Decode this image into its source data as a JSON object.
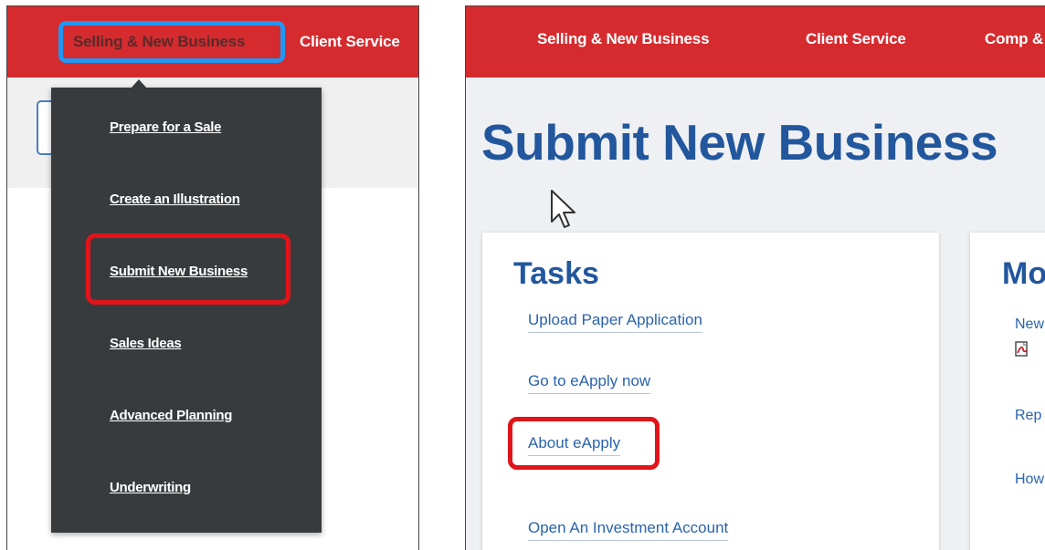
{
  "left": {
    "nav": {
      "selling": "Selling & New Business",
      "client": "Client Service"
    },
    "menu": {
      "items": [
        {
          "label": "Prepare for a Sale"
        },
        {
          "label": "Create an Illustration"
        },
        {
          "label": "Submit New Business"
        },
        {
          "label": "Sales Ideas"
        },
        {
          "label": "Advanced Planning"
        },
        {
          "label": "Underwriting"
        }
      ]
    }
  },
  "right": {
    "nav": {
      "selling": "Selling & New Business",
      "client": "Client Service",
      "comp": "Comp &"
    },
    "title": "Submit New Business",
    "tasks": {
      "title": "Tasks",
      "links": [
        {
          "label": "Upload Paper Application"
        },
        {
          "label": "Go to eApply now"
        },
        {
          "label": "About eApply"
        },
        {
          "label": "Open An Investment Account"
        }
      ]
    },
    "more": {
      "title": "Mo",
      "links": [
        {
          "label": "New"
        },
        {
          "label": "Rep"
        },
        {
          "label": "How"
        }
      ]
    }
  },
  "colors": {
    "brand_red": "#d52b2f",
    "highlight_red": "#e0141a",
    "highlight_blue": "#2196f3",
    "menu_bg": "#383b3d",
    "title_blue": "#22579d",
    "link_blue": "#2a63ad"
  },
  "icons": {
    "pdf": "pdf-icon",
    "cursor": "mouse-pointer-icon"
  }
}
